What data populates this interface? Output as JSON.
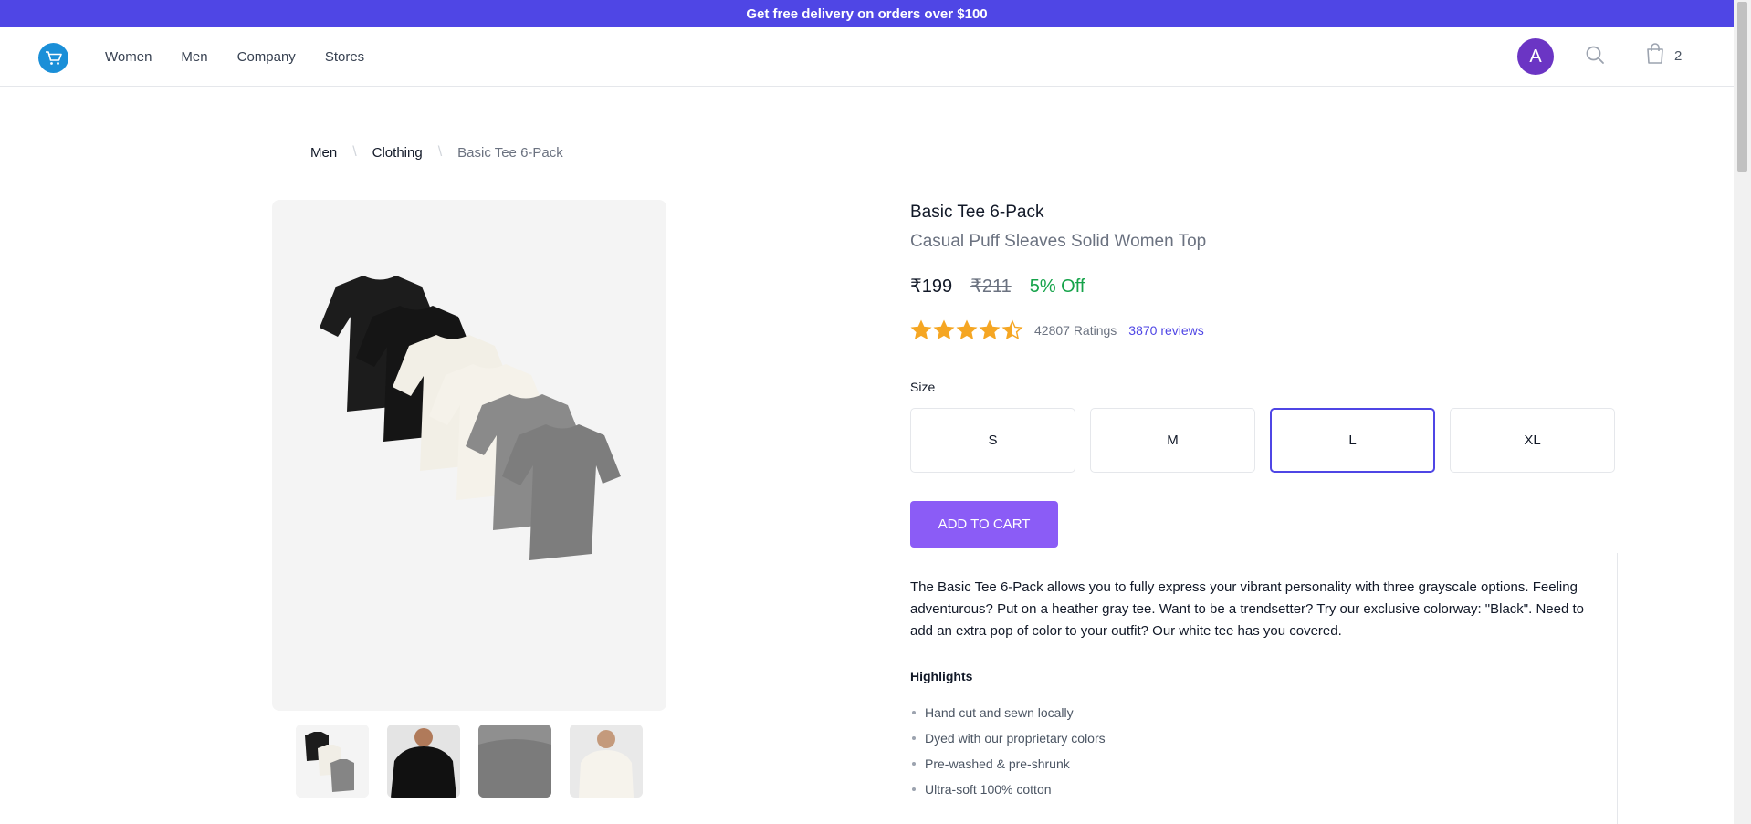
{
  "promo": {
    "text": "Get free delivery on orders over $100"
  },
  "nav": {
    "links": [
      "Women",
      "Men",
      "Company",
      "Stores"
    ],
    "avatar_initial": "A",
    "cart_count": "2"
  },
  "breadcrumb": {
    "items": [
      "Men",
      "Clothing",
      "Basic Tee 6-Pack"
    ]
  },
  "product": {
    "title": "Basic Tee 6-Pack",
    "subtitle": "Casual Puff Sleaves Solid Women Top",
    "price": "₹199",
    "mrp": "₹211",
    "discount": "5% Off",
    "rating_value": 4.5,
    "ratings_text": "42807 Ratings",
    "reviews_text": "3870 reviews",
    "size_label": "Size",
    "sizes": [
      "S",
      "M",
      "L",
      "XL"
    ],
    "selected_size": "L",
    "add_to_cart_label": "ADD TO CART",
    "description": "The Basic Tee 6-Pack allows you to fully express your vibrant personality with three grayscale options. Feeling adventurous? Put on a heather gray tee. Want to be a trendsetter? Try our exclusive colorway: \"Black\". Need to add an extra pop of color to your outfit? Our white tee has you covered.",
    "highlights_title": "Highlights",
    "highlights": [
      "Hand cut and sewn locally",
      "Dyed with our proprietary colors",
      "Pre-washed & pre-shrunk",
      "Ultra-soft 100% cotton"
    ]
  },
  "colors": {
    "accent": "#4f46e5",
    "cart_button": "#8b5cf6",
    "discount": "#16a34a",
    "star": "#f5a623",
    "avatar": "#6b35c4"
  },
  "icons": {
    "logo": "shopping-cart-logo-icon",
    "search": "search-icon",
    "cart": "shopping-bag-icon",
    "star": "star-icon"
  }
}
